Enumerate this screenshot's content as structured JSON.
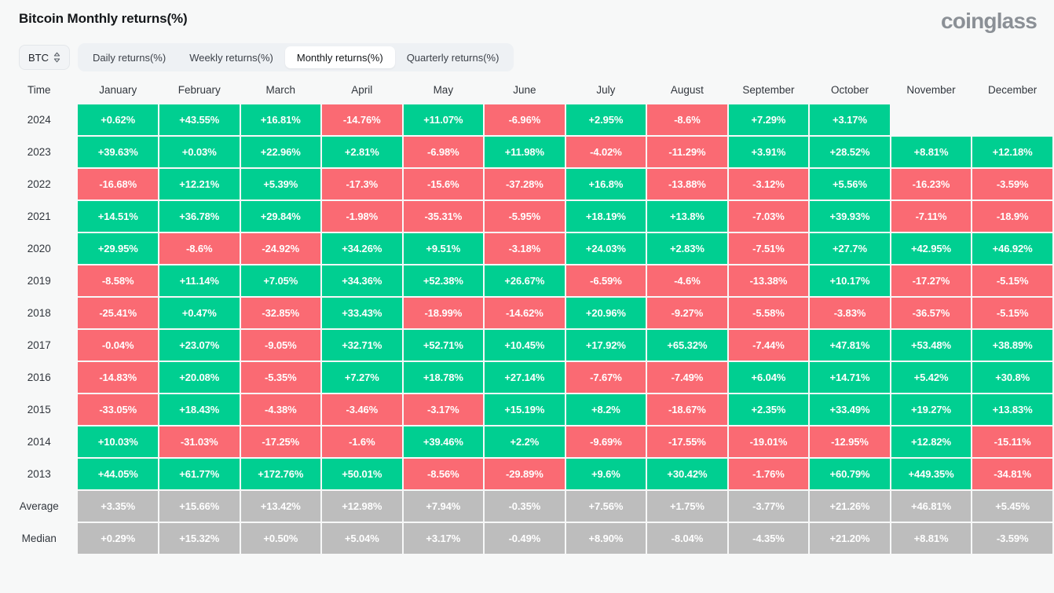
{
  "header": {
    "title": "Bitcoin Monthly returns(%)",
    "brand": "coinglass"
  },
  "controls": {
    "symbol": "BTC",
    "symbol_icon": "chevron-up-down-icon",
    "tabs": [
      {
        "label": "Daily returns(%)",
        "active": false
      },
      {
        "label": "Weekly returns(%)",
        "active": false
      },
      {
        "label": "Monthly returns(%)",
        "active": true
      },
      {
        "label": "Quarterly returns(%)",
        "active": false
      }
    ]
  },
  "colors": {
    "positive": "#00cf91",
    "negative": "#fa6a73",
    "neutral": "#bdbdbd",
    "background": "#f7f8f8",
    "text": "#31363d"
  },
  "chart_data": {
    "type": "heatmap",
    "title": "Bitcoin Monthly returns(%)",
    "xlabel": "",
    "ylabel": "Time",
    "row_header": "Time",
    "categories": [
      "January",
      "February",
      "March",
      "April",
      "May",
      "June",
      "July",
      "August",
      "September",
      "October",
      "November",
      "December"
    ],
    "rows": [
      {
        "label": "2024",
        "type": "year",
        "values": [
          "+0.62%",
          "+43.55%",
          "+16.81%",
          "-14.76%",
          "+11.07%",
          "-6.96%",
          "+2.95%",
          "-8.6%",
          "+7.29%",
          "+3.17%",
          "",
          ""
        ]
      },
      {
        "label": "2023",
        "type": "year",
        "values": [
          "+39.63%",
          "+0.03%",
          "+22.96%",
          "+2.81%",
          "-6.98%",
          "+11.98%",
          "-4.02%",
          "-11.29%",
          "+3.91%",
          "+28.52%",
          "+8.81%",
          "+12.18%"
        ]
      },
      {
        "label": "2022",
        "type": "year",
        "values": [
          "-16.68%",
          "+12.21%",
          "+5.39%",
          "-17.3%",
          "-15.6%",
          "-37.28%",
          "+16.8%",
          "-13.88%",
          "-3.12%",
          "+5.56%",
          "-16.23%",
          "-3.59%"
        ]
      },
      {
        "label": "2021",
        "type": "year",
        "values": [
          "+14.51%",
          "+36.78%",
          "+29.84%",
          "-1.98%",
          "-35.31%",
          "-5.95%",
          "+18.19%",
          "+13.8%",
          "-7.03%",
          "+39.93%",
          "-7.11%",
          "-18.9%"
        ]
      },
      {
        "label": "2020",
        "type": "year",
        "values": [
          "+29.95%",
          "-8.6%",
          "-24.92%",
          "+34.26%",
          "+9.51%",
          "-3.18%",
          "+24.03%",
          "+2.83%",
          "-7.51%",
          "+27.7%",
          "+42.95%",
          "+46.92%"
        ]
      },
      {
        "label": "2019",
        "type": "year",
        "values": [
          "-8.58%",
          "+11.14%",
          "+7.05%",
          "+34.36%",
          "+52.38%",
          "+26.67%",
          "-6.59%",
          "-4.6%",
          "-13.38%",
          "+10.17%",
          "-17.27%",
          "-5.15%"
        ]
      },
      {
        "label": "2018",
        "type": "year",
        "values": [
          "-25.41%",
          "+0.47%",
          "-32.85%",
          "+33.43%",
          "-18.99%",
          "-14.62%",
          "+20.96%",
          "-9.27%",
          "-5.58%",
          "-3.83%",
          "-36.57%",
          "-5.15%"
        ]
      },
      {
        "label": "2017",
        "type": "year",
        "values": [
          "-0.04%",
          "+23.07%",
          "-9.05%",
          "+32.71%",
          "+52.71%",
          "+10.45%",
          "+17.92%",
          "+65.32%",
          "-7.44%",
          "+47.81%",
          "+53.48%",
          "+38.89%"
        ]
      },
      {
        "label": "2016",
        "type": "year",
        "values": [
          "-14.83%",
          "+20.08%",
          "-5.35%",
          "+7.27%",
          "+18.78%",
          "+27.14%",
          "-7.67%",
          "-7.49%",
          "+6.04%",
          "+14.71%",
          "+5.42%",
          "+30.8%"
        ]
      },
      {
        "label": "2015",
        "type": "year",
        "values": [
          "-33.05%",
          "+18.43%",
          "-4.38%",
          "-3.46%",
          "-3.17%",
          "+15.19%",
          "+8.2%",
          "-18.67%",
          "+2.35%",
          "+33.49%",
          "+19.27%",
          "+13.83%"
        ]
      },
      {
        "label": "2014",
        "type": "year",
        "values": [
          "+10.03%",
          "-31.03%",
          "-17.25%",
          "-1.6%",
          "+39.46%",
          "+2.2%",
          "-9.69%",
          "-17.55%",
          "-19.01%",
          "-12.95%",
          "+12.82%",
          "-15.11%"
        ]
      },
      {
        "label": "2013",
        "type": "year",
        "values": [
          "+44.05%",
          "+61.77%",
          "+172.76%",
          "+50.01%",
          "-8.56%",
          "-29.89%",
          "+9.6%",
          "+30.42%",
          "-1.76%",
          "+60.79%",
          "+449.35%",
          "-34.81%"
        ]
      },
      {
        "label": "Average",
        "type": "summary",
        "values": [
          "+3.35%",
          "+15.66%",
          "+13.42%",
          "+12.98%",
          "+7.94%",
          "-0.35%",
          "+7.56%",
          "+1.75%",
          "-3.77%",
          "+21.26%",
          "+46.81%",
          "+5.45%"
        ]
      },
      {
        "label": "Median",
        "type": "summary",
        "values": [
          "+0.29%",
          "+15.32%",
          "+0.50%",
          "+5.04%",
          "+3.17%",
          "-0.49%",
          "+8.90%",
          "-8.04%",
          "-4.35%",
          "+21.20%",
          "+8.81%",
          "-3.59%"
        ]
      }
    ]
  }
}
